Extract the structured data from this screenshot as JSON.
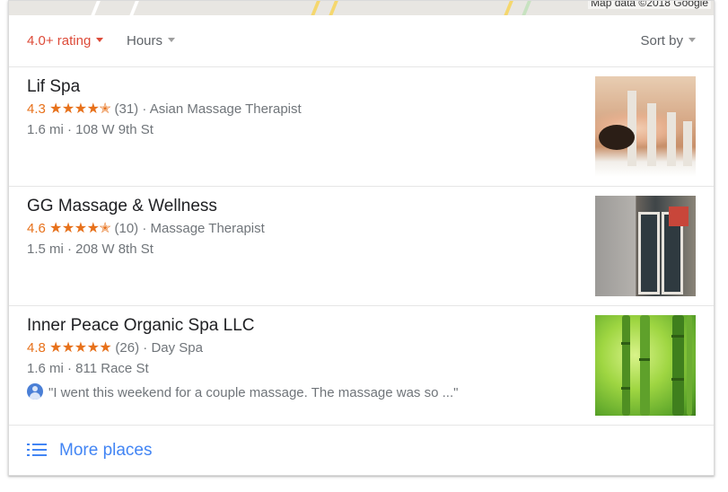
{
  "map": {
    "credit": "Map data ©2018 Google"
  },
  "filters": {
    "rating": "4.0+ rating",
    "hours": "Hours",
    "sort": "Sort by"
  },
  "listings": [
    {
      "name": "Lif Spa",
      "rating": "4.3",
      "stars": "★★★★✭",
      "rating_value": 4.3,
      "reviews": "(31)",
      "category": "Asian Massage Therapist",
      "address": "1.6 mi · 108 W 9th St"
    },
    {
      "name": "GG Massage & Wellness",
      "rating": "4.6",
      "stars": "★★★★✭",
      "rating_value": 4.6,
      "reviews": "(10)",
      "category": "Massage Therapist",
      "address": "1.5 mi · 208 W 8th St"
    },
    {
      "name": "Inner Peace Organic Spa LLC",
      "rating": "4.8",
      "stars": "★★★★★",
      "rating_value": 4.8,
      "reviews": "(26)",
      "category": "Day Spa",
      "address": "1.6 mi · 811 Race St",
      "review": "\"I went this weekend for a couple massage. The massage was so ...\""
    }
  ],
  "more": {
    "label": "More places"
  },
  "colors": {
    "accent_red": "#dd4b39",
    "star_orange": "#e7711b",
    "link_blue": "#4285f4"
  }
}
